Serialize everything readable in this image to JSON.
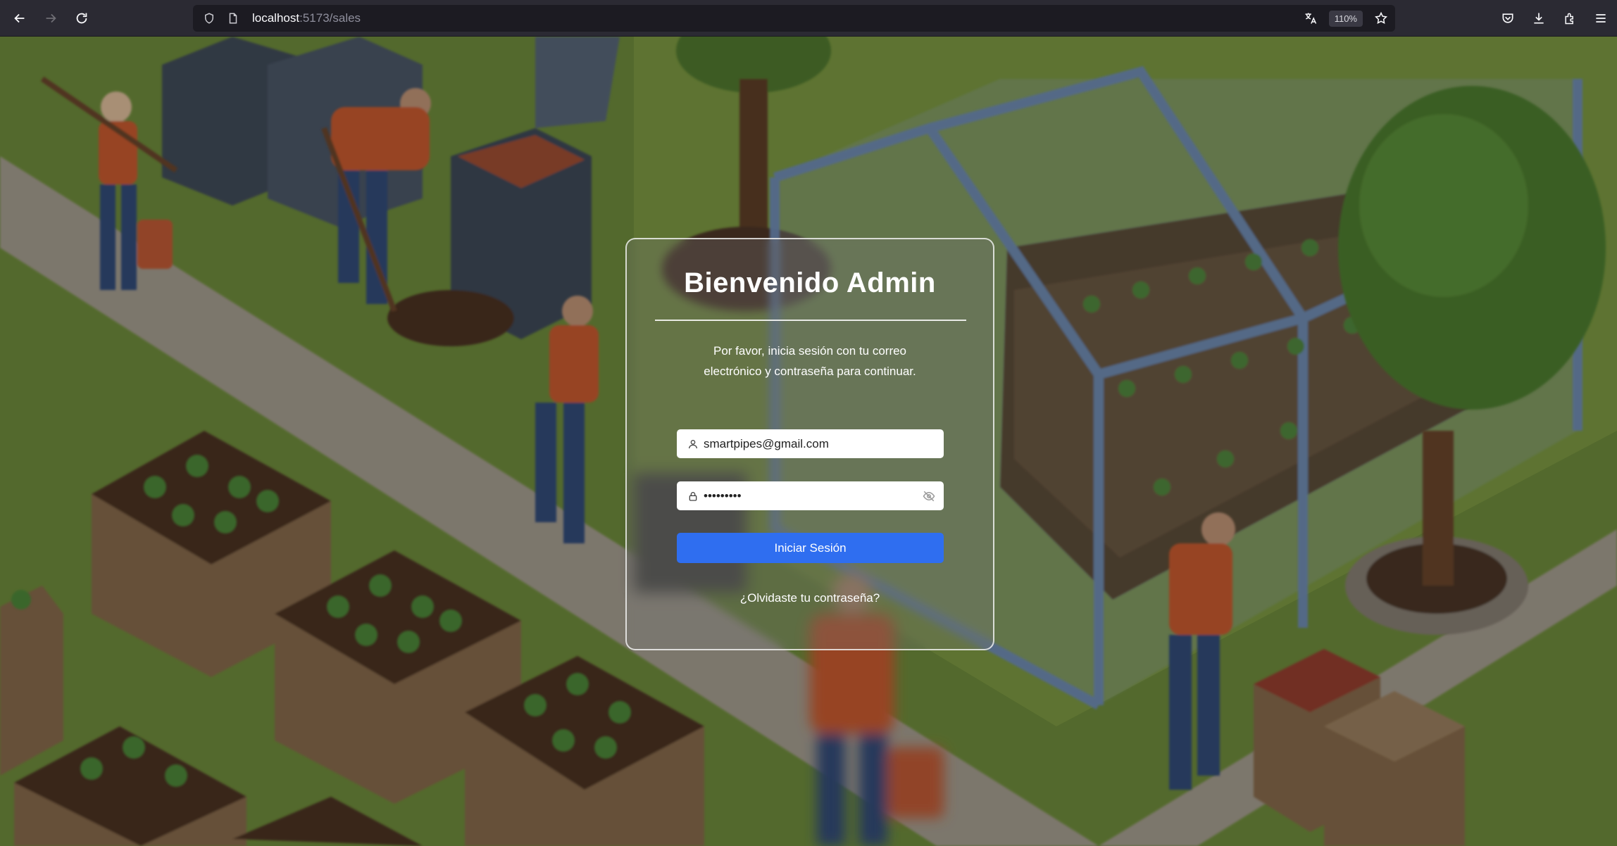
{
  "browser": {
    "url_host": "localhost",
    "url_path": ":5173/sales",
    "zoom": "110%"
  },
  "login": {
    "title": "Bienvenido Admin",
    "subtitle": "Por favor, inicia sesión con tu correo electrónico y contraseña para continuar.",
    "email_value": "smartpipes@gmail.com",
    "password_value": "•••••••••",
    "submit_label": "Iniciar Sesión",
    "forgot_label": "¿Olvidaste tu contraseña?"
  },
  "colors": {
    "button": "#2f6ef0",
    "grass": "#7a9a3e",
    "path": "#b9b1a3"
  }
}
